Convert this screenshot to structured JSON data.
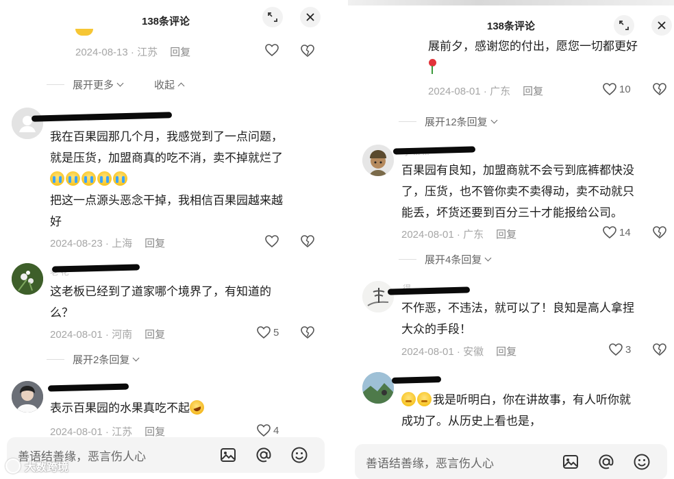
{
  "left": {
    "header_title": "138条评论",
    "top_meta": {
      "date": "2024-08-13",
      "location": "江苏",
      "reply": "回复"
    },
    "expand_more": "展开更多",
    "collapse": "收起",
    "comments": [
      {
        "ghost_name": "",
        "lines": [
          "我在百果园那几个月，我感觉到了一点问题，",
          "就是压货，加盟商真的吃不消，卖不掉就烂了"
        ],
        "extra_lines": [
          "把这一点源头恶念干掉，我相信百果园越来越",
          "好"
        ],
        "date": "2024-08-23",
        "location": "上海",
        "reply": "回复",
        "likes": ""
      },
      {
        "ghost_name": "老   花",
        "lines": [
          "这老板已经到了道家哪个境界了，有知道的",
          "么？"
        ],
        "date": "2024-08-01",
        "location": "河南",
        "reply": "回复",
        "likes": "5",
        "expand": "展开2条回复"
      },
      {
        "ghost_name": "",
        "lines": [
          "表示百果园的水果真吃不起"
        ],
        "date": "2024-08-01",
        "location": "江苏",
        "reply": "回复",
        "likes": "4"
      }
    ],
    "input_placeholder": "善语结善缘，恶言伤人心"
  },
  "right": {
    "header_title": "138条评论",
    "top_text": "展前夕，感谢您的付出，愿您一切都更好",
    "top_meta": {
      "date": "2024-08-01",
      "location": "广东",
      "reply": "回复",
      "likes": "10"
    },
    "top_expand": "展开12条回复",
    "comments": [
      {
        "ghost_name": "小 ...   ...",
        "lines": [
          "百果园有良知，加盟商就不会亏到底裤都快没",
          "了，压货，也不管你卖不卖得动，卖不动就只",
          "能丢，坏货还要到百分三十才能报给公司。"
        ],
        "date": "2024-08-01",
        "location": "广东",
        "reply": "回复",
        "likes": "14",
        "expand": "展开4条回复"
      },
      {
        "ghost_name": "得 ...  ...",
        "lines": [
          "不作恶，不违法，就可以了！良知是高人拿捏",
          "大众的手段！"
        ],
        "date": "2024-08-01",
        "location": "安徽",
        "reply": "回复",
        "likes": "3"
      },
      {
        "ghost_name": "",
        "lines": [
          "我是听明白，你在讲故事，有人听你就",
          "成功了。从历史上看也是，"
        ]
      }
    ],
    "input_placeholder": "善语结善缘，恶言伤人心"
  },
  "watermark": "大数跨境",
  "icons": {
    "expand": "expand-icon",
    "close": "close-icon",
    "heart": "heart-icon",
    "dislike": "broken-heart-icon",
    "image": "image-icon",
    "at": "at-icon",
    "emoji": "emoji-icon"
  }
}
